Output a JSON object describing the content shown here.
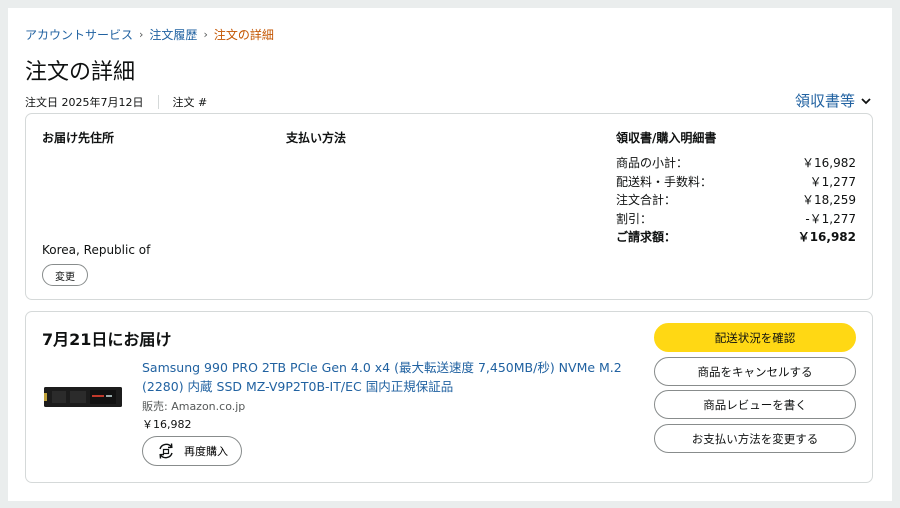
{
  "breadcrumb": {
    "items": [
      "アカウントサービス",
      "注文履歴"
    ],
    "separator": "›",
    "current": "注文の詳細"
  },
  "page_title": "注文の詳細",
  "order_meta": {
    "order_date": "注文日 2025年7月12日",
    "order_number_label": "注文 #"
  },
  "receipt_link": "領収書等",
  "shipping": {
    "heading": "お届け先住所",
    "country": "Korea, Republic of",
    "change_label": "変更"
  },
  "payment": {
    "heading": "支払い方法"
  },
  "summary": {
    "heading": "領収書/購入明細書",
    "rows": [
      {
        "label": "商品の小計：",
        "value": "￥16,982"
      },
      {
        "label": "配送料・手数料：",
        "value": "￥1,277"
      },
      {
        "label": "注文合計：",
        "value": "￥18,259"
      },
      {
        "label": "割引：",
        "value": "-￥1,277"
      }
    ],
    "total": {
      "label": "ご請求額：",
      "value": "￥16,982"
    }
  },
  "delivery": {
    "title": "7月21日にお届け",
    "product_title": "Samsung 990 PRO 2TB PCIe Gen 4.0 x4 (最大転送速度 7,450MB/秒) NVMe M.2 (2280) 内蔵 SSD MZ-V9P2T0B-IT/EC 国内正規保証品",
    "seller": "販売: Amazon.co.jp",
    "price": "￥16,982",
    "buy_again_label": "再度購入"
  },
  "actions": {
    "track": "配送状況を確認",
    "cancel": "商品をキャンセルする",
    "review": "商品レビューを書く",
    "change_payment": "お支払い方法を変更する"
  },
  "colors": {
    "link": "#2162a1",
    "current_crumb": "#c45500",
    "primary_button": "#ffd814",
    "page_bg": "#eaeded"
  }
}
